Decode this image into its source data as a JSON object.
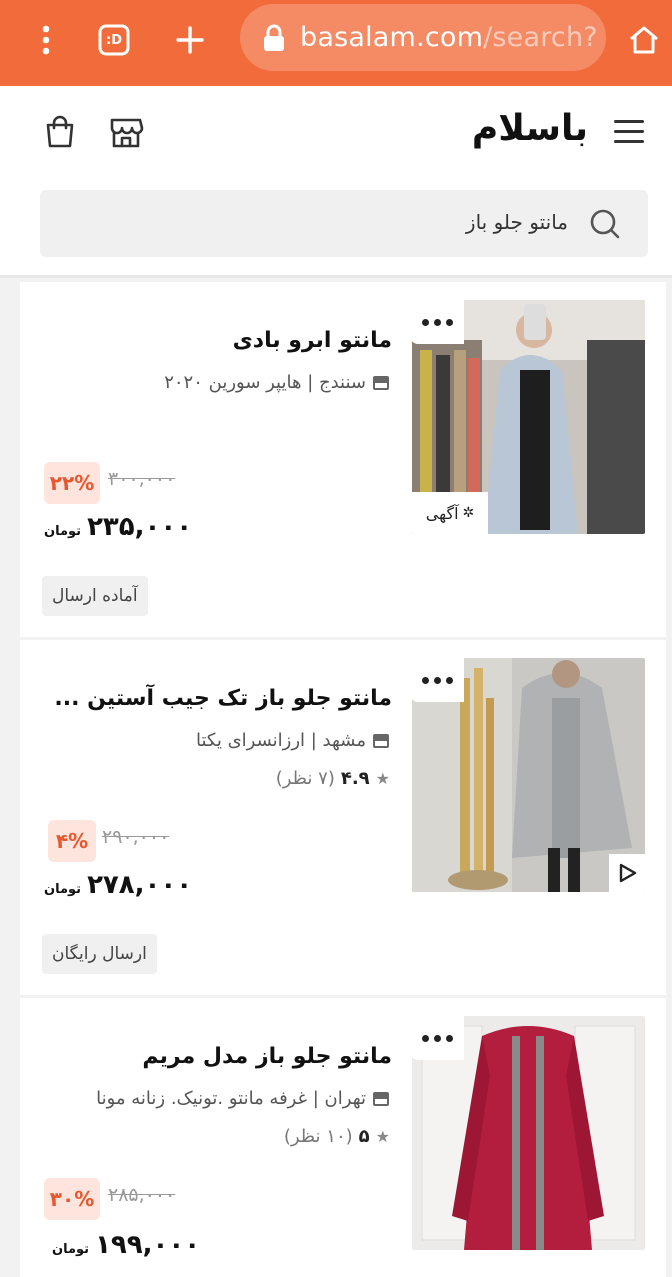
{
  "browser": {
    "url_host": "basalam.com",
    "url_path": "/search?",
    "tab_icon_label": ":D"
  },
  "header": {
    "logo": "باسلام",
    "search_value": "مانتو جلو باز"
  },
  "products": [
    {
      "title": "مانتو ابرو بادی",
      "vendor": "سنندج | هایپر سورین ۲۰۲۰",
      "discount": "۲۲%",
      "old_price": "۳۰۰,۰۰۰",
      "price": "۲۳۵,۰۰۰",
      "currency": "تومان",
      "tag": "آماده ارسال",
      "ad_label": "آگهی"
    },
    {
      "title": "مانتو جلو باز تک جیب آستین ...",
      "vendor": "مشهد | ارزانسرای یکتا",
      "rating": "۴.۹",
      "reviews": "(۷ نظر)",
      "discount": "۴%",
      "old_price": "۲۹۰,۰۰۰",
      "price": "۲۷۸,۰۰۰",
      "currency": "تومان",
      "tag": "ارسال رایگان"
    },
    {
      "title": "مانتو جلو باز مدل مریم",
      "vendor": "تهران | غرفه مانتو .تونیک. زنانه مونا",
      "rating": "۵",
      "reviews": "(۱۰ نظر)",
      "discount": "۳۰%",
      "old_price": "۲۸۵,۰۰۰",
      "price": "۱۹۹,۰۰۰",
      "currency": "تومان"
    }
  ],
  "colors": {
    "brand": "#f26b3a",
    "discount_bg": "#fde4dc",
    "discount_fg": "#e8572d"
  }
}
